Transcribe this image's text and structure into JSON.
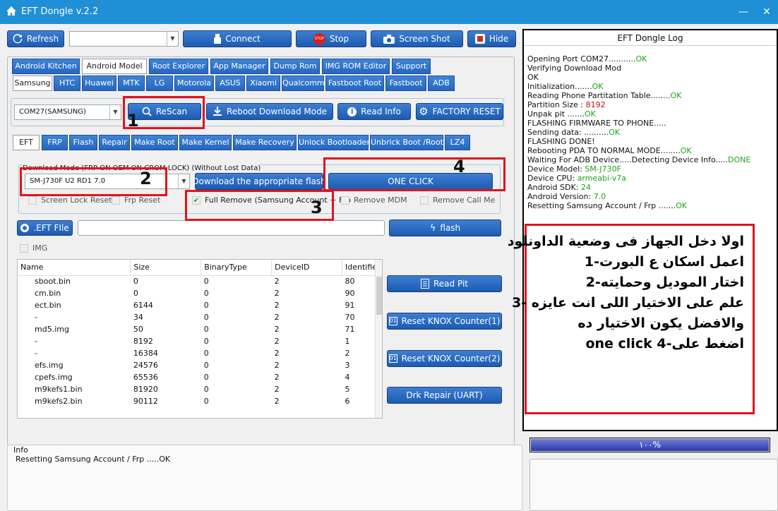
{
  "window": {
    "title": "EFT Dongle  v.2.2",
    "minimize": "—",
    "close": "✕"
  },
  "toolbar": {
    "refresh": "Refresh",
    "connect": "Connect",
    "stop": "Stop",
    "screenshot": "Screen Shot",
    "hide": "Hide",
    "stop_icon_text": "STOP"
  },
  "main_tabs": [
    "Android Kitchen",
    "Android Model",
    "Root Explorer",
    "App Manager",
    "Dump Rom",
    "IMG ROM Editor",
    "Support"
  ],
  "brand_tabs": [
    "Samsung",
    "HTC",
    "Huawei",
    "MTK",
    "LG",
    "Motorola",
    "ASUS",
    "Xiaomi",
    "Qualcomm",
    "Fastboot Root",
    "Fastboot",
    "ADB"
  ],
  "port": {
    "value": "COM27(SAMSUNG)"
  },
  "actions": {
    "rescan": "ReScan",
    "reboot_download": "Reboot  Download Mode",
    "read_info": "Read Info",
    "factory_reset": "FACTORY RESET"
  },
  "sub_tabs": [
    "EFT",
    "FRP",
    "Flash",
    "Repair",
    "Make Root",
    "Make Kernel",
    "Make Recovery",
    "Unlock Bootloader",
    "Unbrick Boot /Root",
    "LZ4"
  ],
  "download_mode": {
    "legend": "Download Mode (FRP ON OEM ON CROM LOCK) (Without Lost Data)",
    "model": "SM-J730F  U2  RD1  7.0",
    "download_flash": "Download the appropriate flash",
    "one_click": "ONE CLICK"
  },
  "checkboxes": {
    "screen_lock": "Screen Lock  Reset",
    "frp_reset": "Frp Reset",
    "full_remove": "Full Remove (Samsung Account + Frp",
    "remove_mdm": "Remove  MDM",
    "remove_call": "Remove Call Me",
    "img": "IMG",
    "check_mark": "✔"
  },
  "file": {
    "button": ".EFT FIle",
    "flash": "flash"
  },
  "table": {
    "headers": [
      "Name",
      "Size",
      "BinaryType",
      "DeviceID",
      "Identifier"
    ],
    "rows": [
      [
        "sboot.bin",
        "0",
        "0",
        "2",
        "80"
      ],
      [
        "cm.bin",
        "0",
        "0",
        "2",
        "90"
      ],
      [
        "ect.bin",
        "6144",
        "0",
        "2",
        "91"
      ],
      [
        "-",
        "34",
        "0",
        "2",
        "70"
      ],
      [
        "md5.img",
        "50",
        "0",
        "2",
        "71"
      ],
      [
        "-",
        "8192",
        "0",
        "2",
        "1"
      ],
      [
        "-",
        "16384",
        "0",
        "2",
        "2"
      ],
      [
        "efs.img",
        "24576",
        "0",
        "2",
        "3"
      ],
      [
        "cpefs.img",
        "65536",
        "0",
        "2",
        "4"
      ],
      [
        "m9kefs1.bin",
        "81920",
        "0",
        "2",
        "5"
      ],
      [
        "m9kefs2.bin",
        "90112",
        "0",
        "2",
        "6"
      ]
    ]
  },
  "side_buttons": {
    "read_pit": "Read Pit",
    "knox1": "Reset KNOX Counter(1)",
    "knox2": "Reset KNOX Counter(2)",
    "drk": "Drk Repair (UART)"
  },
  "info": {
    "title": "Info",
    "text": "Resetting Samsung Account / Frp .....OK"
  },
  "log": {
    "title": "EFT Dongle Log",
    "lines": [
      {
        "t": "Opening Port COM27...........",
        "s": "OK",
        "c": "g"
      },
      {
        "t": "Verifying Download Mod",
        "s": "",
        "c": ""
      },
      {
        "t": "OK",
        "s": "",
        "c": ""
      },
      {
        "t": "Initialization.......",
        "s": "OK",
        "c": "g"
      },
      {
        "t": "Reading Phone Partitation Table........",
        "s": "OK",
        "c": "g"
      },
      {
        "t": "Partition Size : ",
        "s": "8192",
        "c": "r"
      },
      {
        "t": "Unpak pit .......",
        "s": "OK",
        "c": "g"
      },
      {
        "t": "FLASHING FIRMWARE TO PHONE.....",
        "s": "",
        "c": ""
      },
      {
        "t": "Sending data: ..........",
        "s": "OK",
        "c": "g"
      },
      {
        "t": "FLASHING DONE!",
        "s": "",
        "c": ""
      },
      {
        "t": "Rebooting PDA TO NORMAL MODE........",
        "s": "OK",
        "c": "g"
      },
      {
        "t": "Waiting For ADB Device.....Detecting Device Info.....",
        "s": "DONE",
        "c": "g"
      },
      {
        "t": "Device Model: ",
        "s": "SM-J730F",
        "c": "g"
      },
      {
        "t": "Device CPU: ",
        "s": "armeabi-v7a",
        "c": "g"
      },
      {
        "t": "Android SDK: ",
        "s": "24",
        "c": "g"
      },
      {
        "t": "Android Version: ",
        "s": "7.0",
        "c": "g"
      },
      {
        "t": "Resetting Samsung Account / Frp .......",
        "s": "OK",
        "c": "g"
      }
    ]
  },
  "annotation": {
    "lines": [
      "اولا دخل الجهاز فى وضعية الداونلود",
      "اعمل اسكان ع البورت-1",
      "اختار الموديل وحمايته-2",
      "علم على الاختيار اللى انت عايزه -3",
      "والافضل يكون الاختيار ده",
      "اضغط على-4 one click"
    ]
  },
  "markers": [
    "1",
    "2",
    "3",
    "4"
  ],
  "progress": {
    "label": "١٠٠%",
    "value": 1.0
  },
  "colors": {
    "accent": "#1f8fd6",
    "button": "#2567bf",
    "highlight": "#e0141b",
    "ok": "#1aa51a"
  }
}
